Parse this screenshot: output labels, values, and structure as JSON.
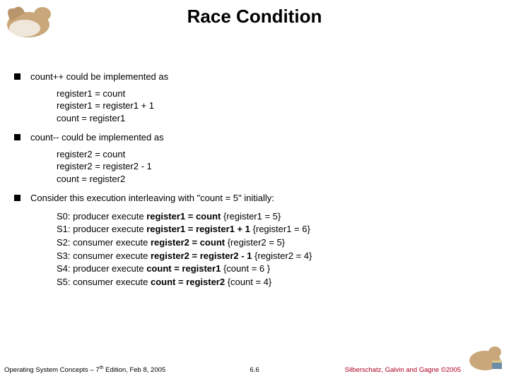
{
  "title": "Race Condition",
  "bullets": {
    "b1": "count++ could be implemented as",
    "b2": "count-- could be implemented as",
    "b3": "Consider this execution interleaving with \"count = 5\" initially:"
  },
  "code1": {
    "l1": "register1 = count",
    "l2": "register1 = register1 + 1",
    "l3": "count = register1"
  },
  "code2": {
    "l1": "register2 = count",
    "l2": "register2 = register2 - 1",
    "l3": "count = register2"
  },
  "steps": {
    "s0": {
      "prefix": "S0: producer execute ",
      "op": "register1 = count",
      "suffix": "   {register1 = 5}"
    },
    "s1": {
      "prefix": "S1: producer execute ",
      "op": "register1 = register1 + 1",
      "suffix": "   {register1 = 6}"
    },
    "s2": {
      "prefix": "S2: consumer execute ",
      "op": "register2 = count",
      "suffix": "   {register2 = 5}"
    },
    "s3": {
      "prefix": "S3: consumer execute ",
      "op": "register2 = register2 - 1",
      "suffix": "   {register2 = 4}"
    },
    "s4": {
      "prefix": "S4: producer execute ",
      "op": "count = register1",
      "suffix": "   {count = 6 }"
    },
    "s5": {
      "prefix": "S5: consumer execute ",
      "op": "count = register2",
      "suffix": "   {count = 4}"
    }
  },
  "footer": {
    "left_a": "Operating System Concepts – 7",
    "left_b": " Edition, Feb 8, 2005",
    "mid": "6.6",
    "right": "Silberschatz, Galvin and Gagne ©2005"
  },
  "colors": {
    "accent_red": "#b00020"
  }
}
